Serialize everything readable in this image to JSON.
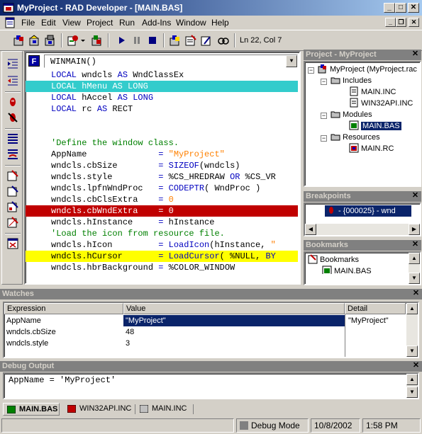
{
  "window": {
    "title": "MyProject - RAD Developer - [MAIN.BAS]",
    "minimize": "_",
    "maximize": "□",
    "close": "✕"
  },
  "menu": {
    "items": [
      "File",
      "Edit",
      "View",
      "Project",
      "Run",
      "Add-Ins",
      "Window",
      "Help"
    ],
    "mdi_minimize": "_",
    "mdi_restore": "❐",
    "mdi_close": "✕"
  },
  "toolbar": {
    "line_col": "Ln 22, Col 7"
  },
  "editor": {
    "proc_badge": "F",
    "proc_name": "WINMAIN()",
    "dropdown_arrow": "▼",
    "lines": [
      {
        "text": "LOCAL wndcls AS WndClassEx"
      },
      {
        "text": "LOCAL hMenu AS LONG"
      },
      {
        "text": "LOCAL hAccel AS LONG"
      },
      {
        "text": "LOCAL rc AS RECT"
      },
      {
        "text": ""
      },
      {
        "text": ""
      },
      {
        "text": "'Define the window class."
      },
      {
        "text": "AppName              = \"MyProject\""
      },
      {
        "text": "wndcls.cbSize        = SIZEOF(wndcls)"
      },
      {
        "text": "wndcls.style         = %CS_HREDRAW OR %CS_VR"
      },
      {
        "text": "wndcls.lpfnWndProc   = CODEPTR( WndProc )"
      },
      {
        "text": "wndcls.cbClsExtra    = 0"
      },
      {
        "text": "wndcls.cbWndExtra    = 0"
      },
      {
        "text": "wndcls.hInstance     = hInstance"
      },
      {
        "text": "'Load the icon from resource file."
      },
      {
        "text": "wndcls.hIcon         = LoadIcon(hInstance, \""
      },
      {
        "text": "wndcls.hCursor       = LoadCursor( %NULL, BY"
      },
      {
        "text": "wndcls.hbrBackground = %COLOR_WINDOW"
      }
    ]
  },
  "project_panel": {
    "title": "Project - MyProject",
    "close": "✕",
    "root": "MyProject (MyProject.rac",
    "includes_label": "Includes",
    "includes": [
      "MAIN.INC",
      "WIN32API.INC"
    ],
    "modules_label": "Modules",
    "modules": [
      "MAIN.BAS"
    ],
    "resources_label": "Resources",
    "resources": [
      "MAIN.RC"
    ]
  },
  "breakpoints_panel": {
    "title": "Breakpoints",
    "close": "✕",
    "items": [
      "- {000025} - wnd"
    ]
  },
  "bookmarks_panel": {
    "title": "Bookmarks",
    "close": "✕",
    "root": "Bookmarks",
    "items": [
      "MAIN.BAS"
    ]
  },
  "watches": {
    "title": "Watches",
    "close": "✕",
    "columns": [
      "Expression",
      "Value",
      "Detail"
    ],
    "rows": [
      {
        "expression": "AppName",
        "value": "\"MyProject\""
      },
      {
        "expression": "wndcls.cbSize",
        "value": "48"
      },
      {
        "expression": "wndcls.style",
        "value": "3"
      }
    ],
    "detail": "\"MyProject\""
  },
  "debug_output": {
    "title": "Debug Output",
    "close": "✕",
    "text": "AppName = 'MyProject'"
  },
  "doc_tabs": [
    "MAIN.BAS",
    "WIN32API.INC",
    "MAIN.INC"
  ],
  "status": {
    "mode": "Debug Mode",
    "date": "10/8/2002",
    "time": "1:58 PM"
  },
  "colors": {
    "title_start": "#0a246a",
    "title_end": "#a6caf0",
    "selection": "#0a246a",
    "current_line": "#33cccc",
    "breakpoint_line": "#c00000",
    "exec_line": "#ffff00",
    "keyword": "#0000c0",
    "string": "#ff8000",
    "comment": "#008000"
  }
}
